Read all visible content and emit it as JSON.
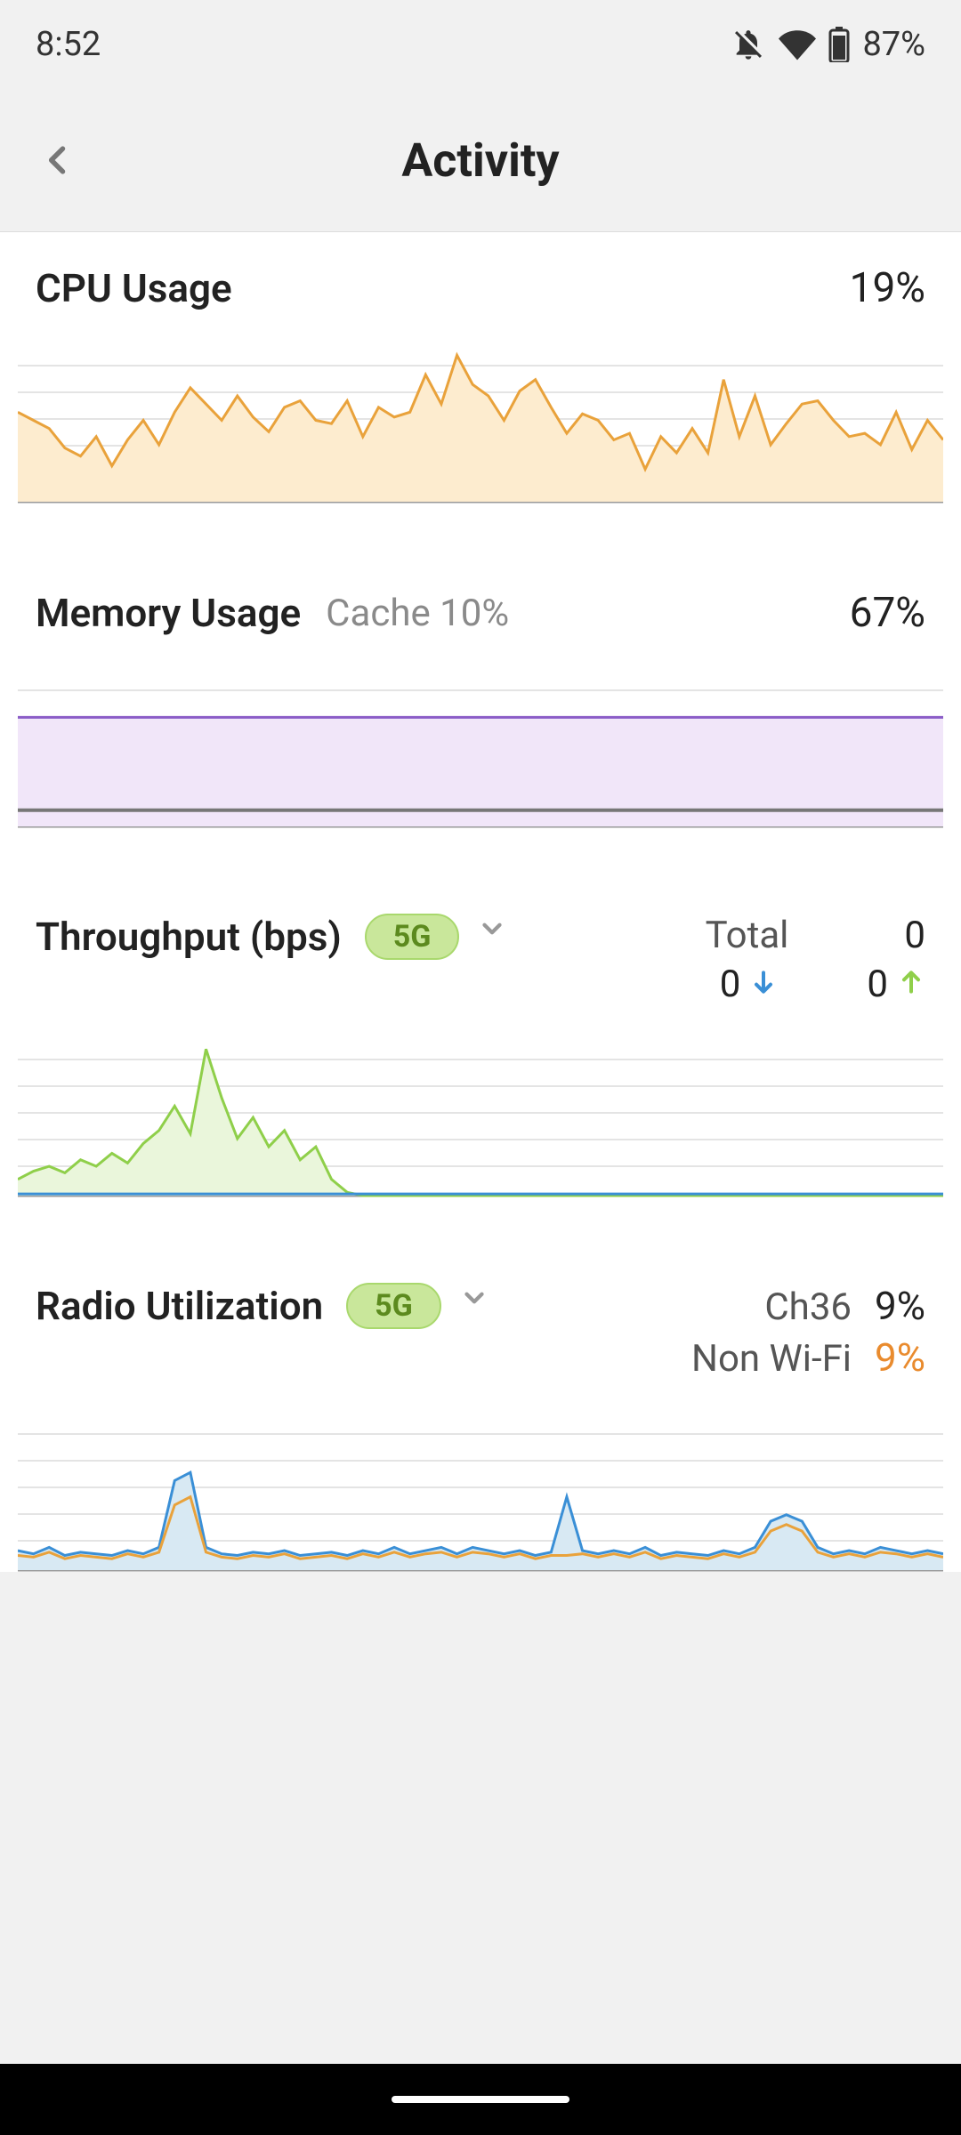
{
  "status_bar": {
    "time": "8:52",
    "battery": "87%"
  },
  "header": {
    "title": "Activity"
  },
  "cpu": {
    "label": "CPU Usage",
    "value": "19%"
  },
  "memory": {
    "label": "Memory Usage",
    "cache_label": "Cache 10%",
    "value": "67%"
  },
  "throughput": {
    "label": "Throughput (bps)",
    "band": "5G",
    "total_label": "Total",
    "total_value": "0",
    "down_value": "0",
    "up_value": "0"
  },
  "radio": {
    "label": "Radio Utilization",
    "band": "5G",
    "ch_label": "Ch36",
    "ch_value": "9%",
    "nonwifi_label": "Non Wi-Fi",
    "nonwifi_value": "9%"
  },
  "chart_data": [
    {
      "type": "area",
      "title": "CPU Usage",
      "ylabel": "%",
      "ylim": [
        0,
        100
      ],
      "x": [
        0,
        1,
        2,
        3,
        4,
        5,
        6,
        7,
        8,
        9,
        10,
        11,
        12,
        13,
        14,
        15,
        16,
        17,
        18,
        19,
        20,
        21,
        22,
        23,
        24,
        25,
        26,
        27,
        28,
        29,
        30,
        31,
        32,
        33,
        34,
        35,
        36,
        37,
        38,
        39,
        40,
        41,
        42,
        43,
        44,
        45,
        46,
        47,
        48,
        49,
        50,
        51,
        52,
        53,
        54,
        55,
        56,
        57,
        58,
        59
      ],
      "values": [
        55,
        50,
        45,
        33,
        28,
        40,
        22,
        38,
        50,
        35,
        55,
        70,
        60,
        50,
        65,
        52,
        43,
        58,
        62,
        50,
        48,
        62,
        40,
        58,
        52,
        55,
        78,
        60,
        90,
        72,
        65,
        50,
        68,
        75,
        58,
        42,
        54,
        50,
        38,
        42,
        20,
        40,
        30,
        45,
        30,
        75,
        40,
        65,
        35,
        48,
        60,
        62,
        50,
        40,
        42,
        35,
        55,
        32,
        50,
        38
      ],
      "color": "#e9a23b"
    },
    {
      "type": "area",
      "title": "Memory Usage",
      "ylabel": "%",
      "ylim": [
        0,
        100
      ],
      "series": [
        {
          "name": "Memory",
          "color": "#8a5cc7",
          "x": [
            0,
            59
          ],
          "values": [
            67,
            67
          ]
        },
        {
          "name": "Cache",
          "color": "#777",
          "x": [
            0,
            59
          ],
          "values": [
            10,
            10
          ]
        }
      ]
    },
    {
      "type": "area",
      "title": "Throughput (bps) 5G",
      "ylim": [
        0,
        100
      ],
      "series": [
        {
          "name": "Up",
          "color": "#8fcf4a",
          "x": [
            0,
            1,
            2,
            3,
            4,
            5,
            6,
            7,
            8,
            9,
            10,
            11,
            12,
            13,
            14,
            15,
            16,
            17,
            18,
            19,
            20,
            21,
            22,
            23,
            24,
            25,
            26,
            27,
            28,
            29,
            30,
            31,
            32,
            33,
            34,
            35,
            36,
            37,
            38,
            39,
            40,
            41,
            42,
            43,
            44,
            45,
            46,
            47,
            48,
            49,
            50,
            51,
            52,
            53,
            54,
            55,
            56,
            57,
            58,
            59
          ],
          "values": [
            10,
            15,
            18,
            14,
            22,
            18,
            26,
            20,
            32,
            40,
            55,
            38,
            90,
            60,
            35,
            48,
            30,
            40,
            22,
            30,
            10,
            2,
            0,
            0,
            0,
            0,
            0,
            0,
            0,
            0,
            0,
            0,
            0,
            0,
            0,
            0,
            0,
            0,
            0,
            0,
            0,
            0,
            0,
            0,
            0,
            0,
            0,
            0,
            0,
            0,
            0,
            0,
            0,
            0,
            0,
            0,
            0,
            0,
            0,
            0
          ]
        },
        {
          "name": "Down",
          "color": "#3a8fd6",
          "x": [
            0,
            59
          ],
          "values": [
            1,
            1
          ]
        }
      ]
    },
    {
      "type": "area",
      "title": "Radio Utilization 5G",
      "ylim": [
        0,
        100
      ],
      "series": [
        {
          "name": "Wi-Fi",
          "color": "#3a8fd6",
          "x": [
            0,
            1,
            2,
            3,
            4,
            5,
            6,
            7,
            8,
            9,
            10,
            11,
            12,
            13,
            14,
            15,
            16,
            17,
            18,
            19,
            20,
            21,
            22,
            23,
            24,
            25,
            26,
            27,
            28,
            29,
            30,
            31,
            32,
            33,
            34,
            35,
            36,
            37,
            38,
            39,
            40,
            41,
            42,
            43,
            44,
            45,
            46,
            47,
            48,
            49,
            50,
            51,
            52,
            53,
            54,
            55,
            56,
            57,
            58,
            59
          ],
          "values": [
            12,
            10,
            14,
            9,
            11,
            10,
            9,
            12,
            10,
            14,
            55,
            60,
            14,
            10,
            9,
            11,
            10,
            12,
            9,
            10,
            11,
            9,
            12,
            10,
            14,
            10,
            12,
            14,
            10,
            14,
            12,
            10,
            12,
            9,
            11,
            45,
            12,
            10,
            12,
            10,
            14,
            9,
            11,
            10,
            9,
            12,
            10,
            14,
            30,
            34,
            30,
            14,
            10,
            12,
            10,
            14,
            12,
            10,
            12,
            10
          ]
        },
        {
          "name": "Non Wi-Fi",
          "color": "#e9a23b",
          "x": [
            0,
            1,
            2,
            3,
            4,
            5,
            6,
            7,
            8,
            9,
            10,
            11,
            12,
            13,
            14,
            15,
            16,
            17,
            18,
            19,
            20,
            21,
            22,
            23,
            24,
            25,
            26,
            27,
            28,
            29,
            30,
            31,
            32,
            33,
            34,
            35,
            36,
            37,
            38,
            39,
            40,
            41,
            42,
            43,
            44,
            45,
            46,
            47,
            48,
            49,
            50,
            51,
            52,
            53,
            54,
            55,
            56,
            57,
            58,
            59
          ],
          "values": [
            9,
            8,
            11,
            7,
            9,
            8,
            7,
            10,
            8,
            11,
            40,
            45,
            11,
            8,
            7,
            9,
            8,
            10,
            7,
            8,
            9,
            7,
            10,
            8,
            11,
            8,
            10,
            11,
            8,
            11,
            10,
            8,
            10,
            7,
            9,
            9,
            10,
            8,
            10,
            8,
            11,
            7,
            9,
            8,
            7,
            10,
            8,
            11,
            24,
            28,
            24,
            11,
            8,
            10,
            8,
            11,
            10,
            8,
            10,
            8
          ]
        }
      ]
    }
  ]
}
